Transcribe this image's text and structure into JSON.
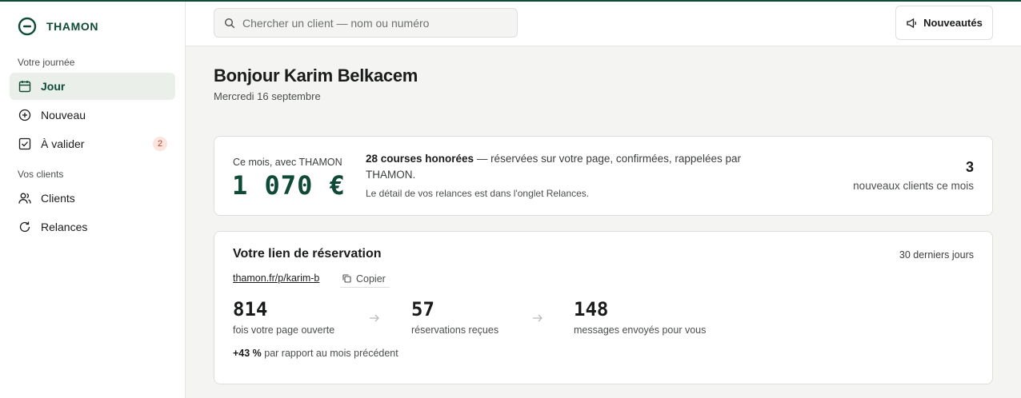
{
  "brand": {
    "name": "THAMON"
  },
  "sidebar": {
    "sections": [
      {
        "label": "Votre journée"
      },
      {
        "label": "Vos clients"
      }
    ],
    "items": [
      {
        "label": "Jour",
        "icon": "calendar-icon",
        "active": true
      },
      {
        "label": "Nouveau",
        "icon": "plus-circle-icon"
      },
      {
        "label": "À valider",
        "icon": "checkbox-icon",
        "badge": "2"
      },
      {
        "label": "Clients",
        "icon": "users-icon"
      },
      {
        "label": "Relances",
        "icon": "refresh-icon"
      }
    ]
  },
  "topbar": {
    "search_placeholder": "Chercher un client — nom ou numéro",
    "news_label": "Nouveautés"
  },
  "main": {
    "greeting": "Bonjour Karim Belkacem",
    "date": "Mercredi 16 septembre",
    "month_card": {
      "label": "Ce mois, avec THAMON",
      "amount": "1 070 €",
      "highlight": "28 courses honorées",
      "description": " — réservées sur votre page, confirmées, rappelées par THAMON.",
      "note": "Le détail de vos relances est dans l'onglet Relances.",
      "new_clients_count": "3",
      "new_clients_label": "nouveaux clients ce mois"
    },
    "link_card": {
      "title": "Votre lien de réservation",
      "period": "30 derniers jours",
      "url": "thamon.fr/p/karim-b",
      "copy_label": "Copier",
      "stats": [
        {
          "value": "814",
          "label": "fois votre page ouverte"
        },
        {
          "value": "57",
          "label": "réservations reçues"
        },
        {
          "value": "148",
          "label": "messages envoyés pour vous"
        }
      ],
      "trend_value": "+43 %",
      "trend_label": " par rapport au mois précédent"
    }
  },
  "colors": {
    "brand": "#0f4a37",
    "active_bg": "#eaefea",
    "badge_bg": "#fbe5dc",
    "badge_text": "#c0452a",
    "page_bg": "#f4f5f3"
  }
}
